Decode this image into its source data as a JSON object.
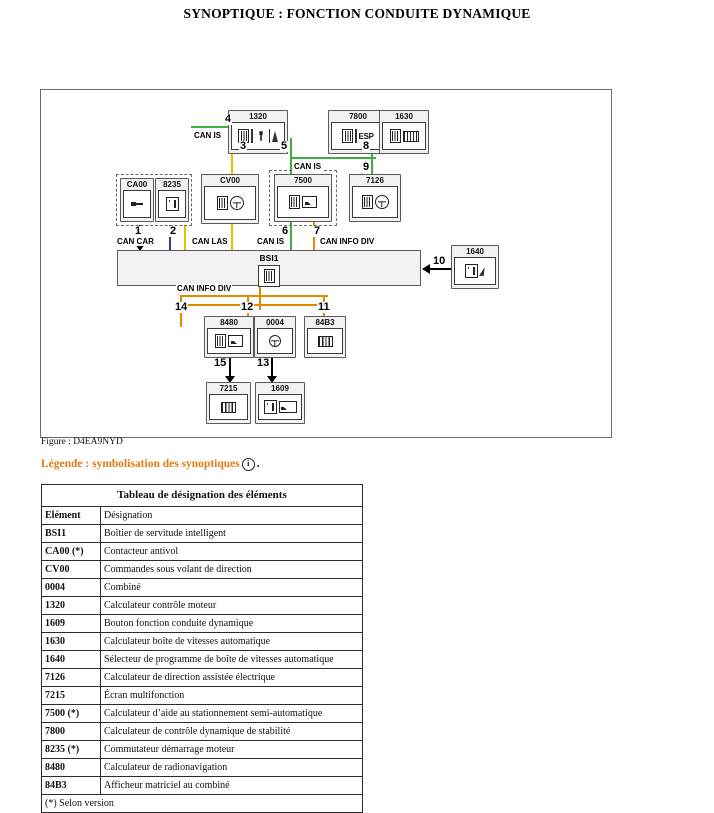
{
  "page": {
    "title": "SYNOPTIQUE : FONCTION CONDUITE DYNAMIQUE",
    "figure_caption": "Figure : D4EA9NYD",
    "legend_text": "Légende : symbolisation des synoptiques",
    "legend_icon": "info-icon",
    "legend_suffix": "."
  },
  "diagram": {
    "nodes": [
      {
        "id": "1320",
        "ref": "1320",
        "icon": "ecu-engine-icon"
      },
      {
        "id": "7800",
        "ref": "7800",
        "icon": "esp-icon"
      },
      {
        "id": "1630",
        "ref": "1630",
        "icon": "gearbox-icon"
      },
      {
        "id": "CA00",
        "ref": "CA00",
        "icon": "antitheft-switch-icon"
      },
      {
        "id": "8235",
        "ref": "8235",
        "icon": "starter-switch-icon"
      },
      {
        "id": "CV00",
        "ref": "CV00",
        "icon": "steering-controls-icon"
      },
      {
        "id": "7500",
        "ref": "7500",
        "icon": "parking-aid-icon"
      },
      {
        "id": "7126",
        "ref": "7126",
        "icon": "eps-steering-icon"
      },
      {
        "id": "BSI1",
        "ref": "BSI1",
        "icon": "bsi-connector-icon"
      },
      {
        "id": "1640",
        "ref": "1640",
        "icon": "gear-selector-icon"
      },
      {
        "id": "8480",
        "ref": "8480",
        "icon": "radionav-icon"
      },
      {
        "id": "0004",
        "ref": "0004",
        "icon": "cluster-icon"
      },
      {
        "id": "84B3",
        "ref": "84B3",
        "icon": "matrix-display-icon"
      },
      {
        "id": "7215",
        "ref": "7215",
        "icon": "multifunction-screen-icon"
      },
      {
        "id": "1609",
        "ref": "1609",
        "icon": "dynamic-button-icon"
      }
    ],
    "link_numbers": [
      "1",
      "2",
      "3",
      "4",
      "5",
      "6",
      "7",
      "8",
      "9",
      "10",
      "11",
      "12",
      "13",
      "14",
      "15"
    ],
    "bus_labels": {
      "can_is_top": "CAN IS",
      "can_is_mid": "CAN IS",
      "can_car": "CAN CAR",
      "can_las": "CAN LAS",
      "can_is_bsi": "CAN IS",
      "can_info_div_bsi": "CAN INFO DIV",
      "can_info_div_bottom": "CAN INFO DIV"
    },
    "colors": {
      "can_is": "#8ee38e",
      "can_las": "#ffef5e",
      "can_info_div": "#ffc35c",
      "can_car": "#b9b9e8",
      "box_fill": "#f2f2f2",
      "box_border": "#5a5a5a"
    }
  },
  "table": {
    "title": "Tableau de désignation des éléments",
    "headers": [
      "Elément",
      "Désignation"
    ],
    "rows": [
      [
        "BSI1",
        "Boîtier de servitude intelligent"
      ],
      [
        "CA00 (*)",
        "Contacteur antivol"
      ],
      [
        "CV00",
        "Commandes sous volant de direction"
      ],
      [
        "0004",
        "Combiné"
      ],
      [
        "1320",
        "Calculateur contrôle moteur"
      ],
      [
        "1609",
        "Bouton fonction conduite dynamique"
      ],
      [
        "1630",
        "Calculateur boîte de vitesses automatique"
      ],
      [
        "1640",
        "Sélecteur de programme de boîte de vitesses automatique"
      ],
      [
        "7126",
        "Calculateur de direction assistée électrique"
      ],
      [
        "7215",
        "Écran multifonction"
      ],
      [
        "7500 (*)",
        "Calculateur d’aide au stationnement semi-automatique"
      ],
      [
        "7800",
        "Calculateur de contrôle dynamique de stabilité"
      ],
      [
        "8235 (*)",
        "Commutateur démarrage moteur"
      ],
      [
        "8480",
        "Calculateur de radionavigation"
      ],
      [
        "84B3",
        "Afficheur matriciel au combiné"
      ]
    ],
    "footnote": "(*) Selon version"
  }
}
